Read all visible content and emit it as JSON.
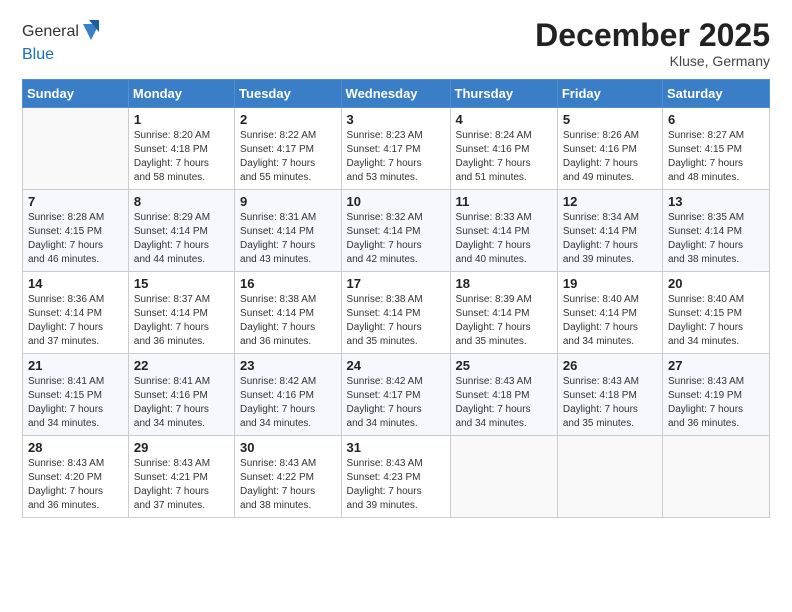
{
  "logo": {
    "general": "General",
    "blue": "Blue"
  },
  "header": {
    "month": "December 2025",
    "location": "Kluse, Germany"
  },
  "weekdays": [
    "Sunday",
    "Monday",
    "Tuesday",
    "Wednesday",
    "Thursday",
    "Friday",
    "Saturday"
  ],
  "weeks": [
    [
      {
        "day": "",
        "info": ""
      },
      {
        "day": "1",
        "info": "Sunrise: 8:20 AM\nSunset: 4:18 PM\nDaylight: 7 hours\nand 58 minutes."
      },
      {
        "day": "2",
        "info": "Sunrise: 8:22 AM\nSunset: 4:17 PM\nDaylight: 7 hours\nand 55 minutes."
      },
      {
        "day": "3",
        "info": "Sunrise: 8:23 AM\nSunset: 4:17 PM\nDaylight: 7 hours\nand 53 minutes."
      },
      {
        "day": "4",
        "info": "Sunrise: 8:24 AM\nSunset: 4:16 PM\nDaylight: 7 hours\nand 51 minutes."
      },
      {
        "day": "5",
        "info": "Sunrise: 8:26 AM\nSunset: 4:16 PM\nDaylight: 7 hours\nand 49 minutes."
      },
      {
        "day": "6",
        "info": "Sunrise: 8:27 AM\nSunset: 4:15 PM\nDaylight: 7 hours\nand 48 minutes."
      }
    ],
    [
      {
        "day": "7",
        "info": "Sunrise: 8:28 AM\nSunset: 4:15 PM\nDaylight: 7 hours\nand 46 minutes."
      },
      {
        "day": "8",
        "info": "Sunrise: 8:29 AM\nSunset: 4:14 PM\nDaylight: 7 hours\nand 44 minutes."
      },
      {
        "day": "9",
        "info": "Sunrise: 8:31 AM\nSunset: 4:14 PM\nDaylight: 7 hours\nand 43 minutes."
      },
      {
        "day": "10",
        "info": "Sunrise: 8:32 AM\nSunset: 4:14 PM\nDaylight: 7 hours\nand 42 minutes."
      },
      {
        "day": "11",
        "info": "Sunrise: 8:33 AM\nSunset: 4:14 PM\nDaylight: 7 hours\nand 40 minutes."
      },
      {
        "day": "12",
        "info": "Sunrise: 8:34 AM\nSunset: 4:14 PM\nDaylight: 7 hours\nand 39 minutes."
      },
      {
        "day": "13",
        "info": "Sunrise: 8:35 AM\nSunset: 4:14 PM\nDaylight: 7 hours\nand 38 minutes."
      }
    ],
    [
      {
        "day": "14",
        "info": "Sunrise: 8:36 AM\nSunset: 4:14 PM\nDaylight: 7 hours\nand 37 minutes."
      },
      {
        "day": "15",
        "info": "Sunrise: 8:37 AM\nSunset: 4:14 PM\nDaylight: 7 hours\nand 36 minutes."
      },
      {
        "day": "16",
        "info": "Sunrise: 8:38 AM\nSunset: 4:14 PM\nDaylight: 7 hours\nand 36 minutes."
      },
      {
        "day": "17",
        "info": "Sunrise: 8:38 AM\nSunset: 4:14 PM\nDaylight: 7 hours\nand 35 minutes."
      },
      {
        "day": "18",
        "info": "Sunrise: 8:39 AM\nSunset: 4:14 PM\nDaylight: 7 hours\nand 35 minutes."
      },
      {
        "day": "19",
        "info": "Sunrise: 8:40 AM\nSunset: 4:14 PM\nDaylight: 7 hours\nand 34 minutes."
      },
      {
        "day": "20",
        "info": "Sunrise: 8:40 AM\nSunset: 4:15 PM\nDaylight: 7 hours\nand 34 minutes."
      }
    ],
    [
      {
        "day": "21",
        "info": "Sunrise: 8:41 AM\nSunset: 4:15 PM\nDaylight: 7 hours\nand 34 minutes."
      },
      {
        "day": "22",
        "info": "Sunrise: 8:41 AM\nSunset: 4:16 PM\nDaylight: 7 hours\nand 34 minutes."
      },
      {
        "day": "23",
        "info": "Sunrise: 8:42 AM\nSunset: 4:16 PM\nDaylight: 7 hours\nand 34 minutes."
      },
      {
        "day": "24",
        "info": "Sunrise: 8:42 AM\nSunset: 4:17 PM\nDaylight: 7 hours\nand 34 minutes."
      },
      {
        "day": "25",
        "info": "Sunrise: 8:43 AM\nSunset: 4:18 PM\nDaylight: 7 hours\nand 34 minutes."
      },
      {
        "day": "26",
        "info": "Sunrise: 8:43 AM\nSunset: 4:18 PM\nDaylight: 7 hours\nand 35 minutes."
      },
      {
        "day": "27",
        "info": "Sunrise: 8:43 AM\nSunset: 4:19 PM\nDaylight: 7 hours\nand 36 minutes."
      }
    ],
    [
      {
        "day": "28",
        "info": "Sunrise: 8:43 AM\nSunset: 4:20 PM\nDaylight: 7 hours\nand 36 minutes."
      },
      {
        "day": "29",
        "info": "Sunrise: 8:43 AM\nSunset: 4:21 PM\nDaylight: 7 hours\nand 37 minutes."
      },
      {
        "day": "30",
        "info": "Sunrise: 8:43 AM\nSunset: 4:22 PM\nDaylight: 7 hours\nand 38 minutes."
      },
      {
        "day": "31",
        "info": "Sunrise: 8:43 AM\nSunset: 4:23 PM\nDaylight: 7 hours\nand 39 minutes."
      },
      {
        "day": "",
        "info": ""
      },
      {
        "day": "",
        "info": ""
      },
      {
        "day": "",
        "info": ""
      }
    ]
  ]
}
